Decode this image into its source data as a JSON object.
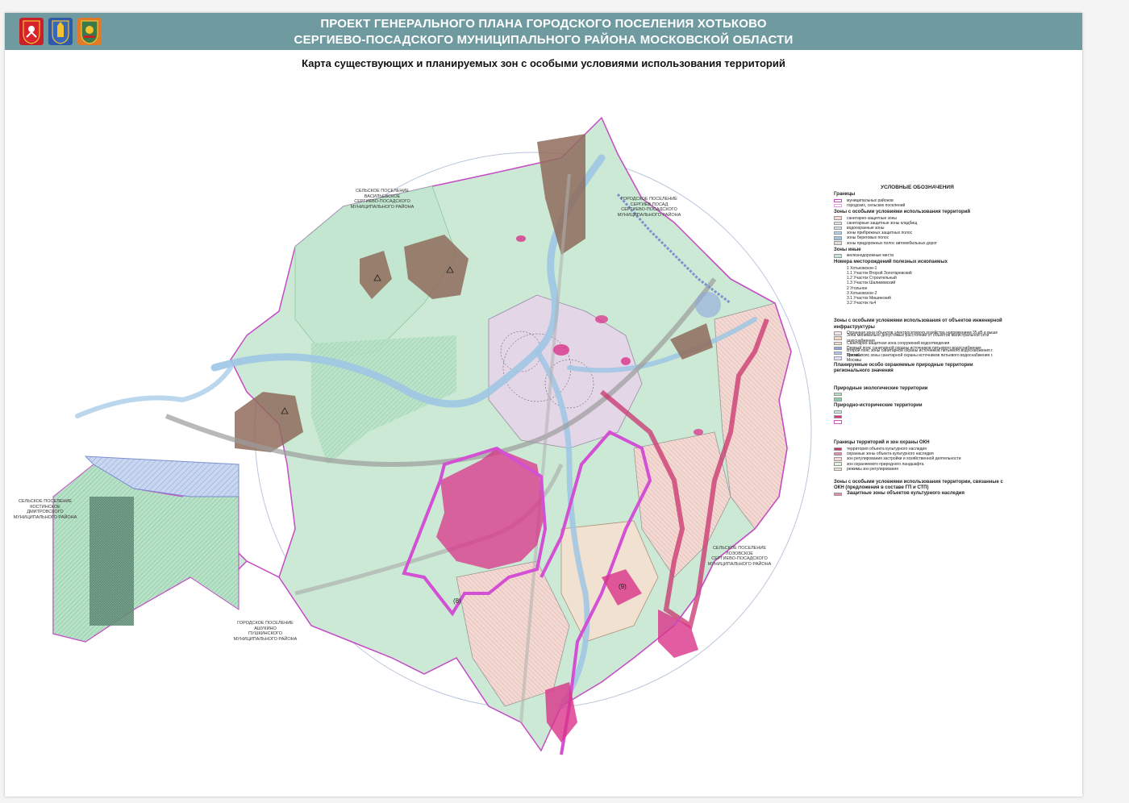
{
  "header": {
    "title_line1": "ПРОЕКТ ГЕНЕРАЛЬНОГО ПЛАНА ГОРОДСКОГО ПОСЕЛЕНИЯ ХОТЬКОВО",
    "title_line2": "СЕРГИЕВО-ПОСАДСКОГО МУНИЦИПАЛЬНОГО РАЙОНА МОСКОВСКОЙ ОБЛАСТИ",
    "subtitle": "Карта существующих и планируемых зон с особыми условиями использования территорий",
    "emblem_icons": [
      "moscow-oblast-coat-of-arms-icon",
      "district-coat-of-arms-icon",
      "khotkovo-coat-of-arms-icon"
    ]
  },
  "neighbors": {
    "north_west": [
      "СЕЛЬСКОЕ ПОСЕЛЕНИЕ",
      "ВАСИЛЬЕВСКОЕ",
      "СЕРГИЕВО-ПОСАДСКОГО",
      "МУНИЦИПАЛЬНОГО РАЙОНА"
    ],
    "north_east": [
      "ГОРОДСКОЕ ПОСЕЛЕНИЕ",
      "СЕРГИЕВ ПОСАД",
      "СЕРГИЕВО-ПОСАДСКОГО",
      "МУНИЦИПАЛЬНОГО РАЙОНА"
    ],
    "west": [
      "СЕЛЬСКОЕ ПОСЕЛЕНИЕ",
      "КОСТИНСКОЕ",
      "ДМИТРОВСКОГО",
      "МУНИЦИПАЛЬНОГО РАЙОНА"
    ],
    "south_west": [
      "ГОРОДСКОЕ ПОСЕЛЕНИЕ",
      "АШУКИНО",
      "ПУШКИНСКОГО",
      "МУНИЦИПАЛЬНОГО РАЙОНА"
    ],
    "south_east": [
      "СЕЛЬСКОЕ ПОСЕЛЕНИЕ",
      "ЛОЗОВСКОЕ",
      "СЕРГИЕВО-ПОСАДСКОГО",
      "МУНИЦИПАЛЬНОГО РАЙОНА"
    ]
  },
  "map_labels": {
    "zone8": "(8)",
    "zone9": "(9)"
  },
  "legend": {
    "title": "УСЛОВНЫЕ ОБОЗНАЧЕНИЯ",
    "h_borders": "Границы",
    "b1": "муниципальных районов",
    "b2": "городских, сельских поселений",
    "h_zones": "Зоны с особыми условиями использования территорий",
    "z1": "санитарно-защитные зоны",
    "z2": "санитарные защитные зоны кладбищ",
    "z3": "водоохранные зоны",
    "z4": "зоны прибрежных защитных полос",
    "z5": "зоны береговых полос",
    "z6": "зоны придорожных полос автомобильных дорог",
    "h_other": "Зоны иные",
    "o1": "железнодорожные места",
    "h_deposits": "Номера месторождений полезных ископаемых",
    "d1": "1 Хотьковское-1",
    "d2": "1.1 Участок Второй Золотаревский",
    "d3": "1.2 Участок Строительный",
    "d4": "1.3 Участок Шалимовский",
    "d5": "2 Угольное",
    "d6": "3 Хотьковское-2",
    "d7": "3.1 Участок Мишинский",
    "d8": "3.2 Участок №4",
    "h_infra": "Зоны с особыми условиями использования от объектов инженерной инфраструктуры",
    "i1": "Охранная зона объектов электросетевого хозяйства напряжением 35 кВ и выше",
    "i2": "Зона минимально допустимых расстояний от объектов магистральной сети газоснабжения",
    "i3": "Санитарно-защитная зона сооружений водоотведения",
    "i4": "Первый пояс санитарной охраны источников питьевого водоснабжения",
    "i5": "Второй пояс зоны санитарной охраны источников питьевого водоснабжения г. Москвы",
    "i6": "Третий пояс зоны санитарной охраны источников питьевого водоснабжения г. Москвы",
    "h_natural": "Планируемые особо охраняемые природные территории регионального значения",
    "h_eco": "Природные экологические территории",
    "h_hist": "Природно-исторические территории",
    "h_okn": "Границы территорий и зон охраны ОКН",
    "k1": "территория объекта культурного наследия",
    "k2": "охранные зоны объекта культурного наследия",
    "k3": "зон регулирования застройки и хозяйственной деятельности",
    "k4": "зон охраняемого природного ландшафта",
    "k5": "режимы зон регулирования",
    "h_okn2": "Зоны с особыми условиями использования территории, связанные с ОКН (предложения в составе ГП и СТП)",
    "h_prot": "Защитные зоны объектов культурного наследия"
  },
  "colors": {
    "header": "#6f9aa0",
    "green_zone": "#bfe3cc",
    "protected_magenta": "#d9338a",
    "water_blue": "#9fc6e4",
    "brown_deposit": "#8f6b5c",
    "pink_boundary": "#cc44cc"
  }
}
